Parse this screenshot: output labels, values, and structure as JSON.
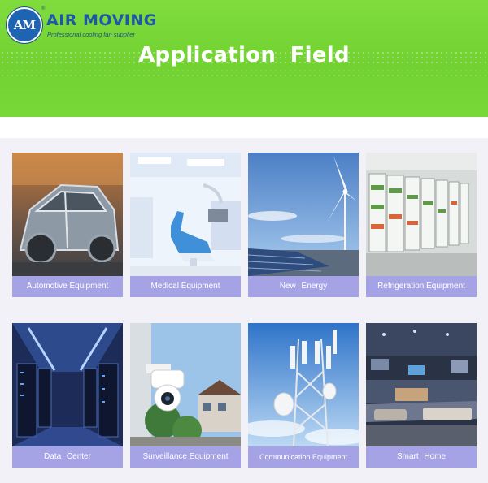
{
  "header": {
    "logo_text": "AM",
    "registered_mark": "®",
    "brand_name": "AIR MOVING",
    "tagline": "Professional cooling fan supplier",
    "title": "Application  Field"
  },
  "colors": {
    "banner_green": "#72d232",
    "caption_lavender": "#a5a3e6",
    "brand_blue": "#1f57a8",
    "panel_bg": "#f3f1f8"
  },
  "applications": [
    {
      "label": "Automotive Equipment",
      "icon": "car-body-icon"
    },
    {
      "label": "Medical Equipment",
      "icon": "dental-chair-icon"
    },
    {
      "label": "New  Energy",
      "icon": "wind-turbine-icon"
    },
    {
      "label": "Refrigeration Equipment",
      "icon": "fridge-display-icon"
    },
    {
      "label": "Data  Center",
      "icon": "server-rack-icon"
    },
    {
      "label": "Surveillance Equipment",
      "icon": "security-camera-icon"
    },
    {
      "label": "Communication Equipment",
      "icon": "cell-tower-icon"
    },
    {
      "label": "Smart  Home",
      "icon": "smart-home-icon"
    }
  ]
}
